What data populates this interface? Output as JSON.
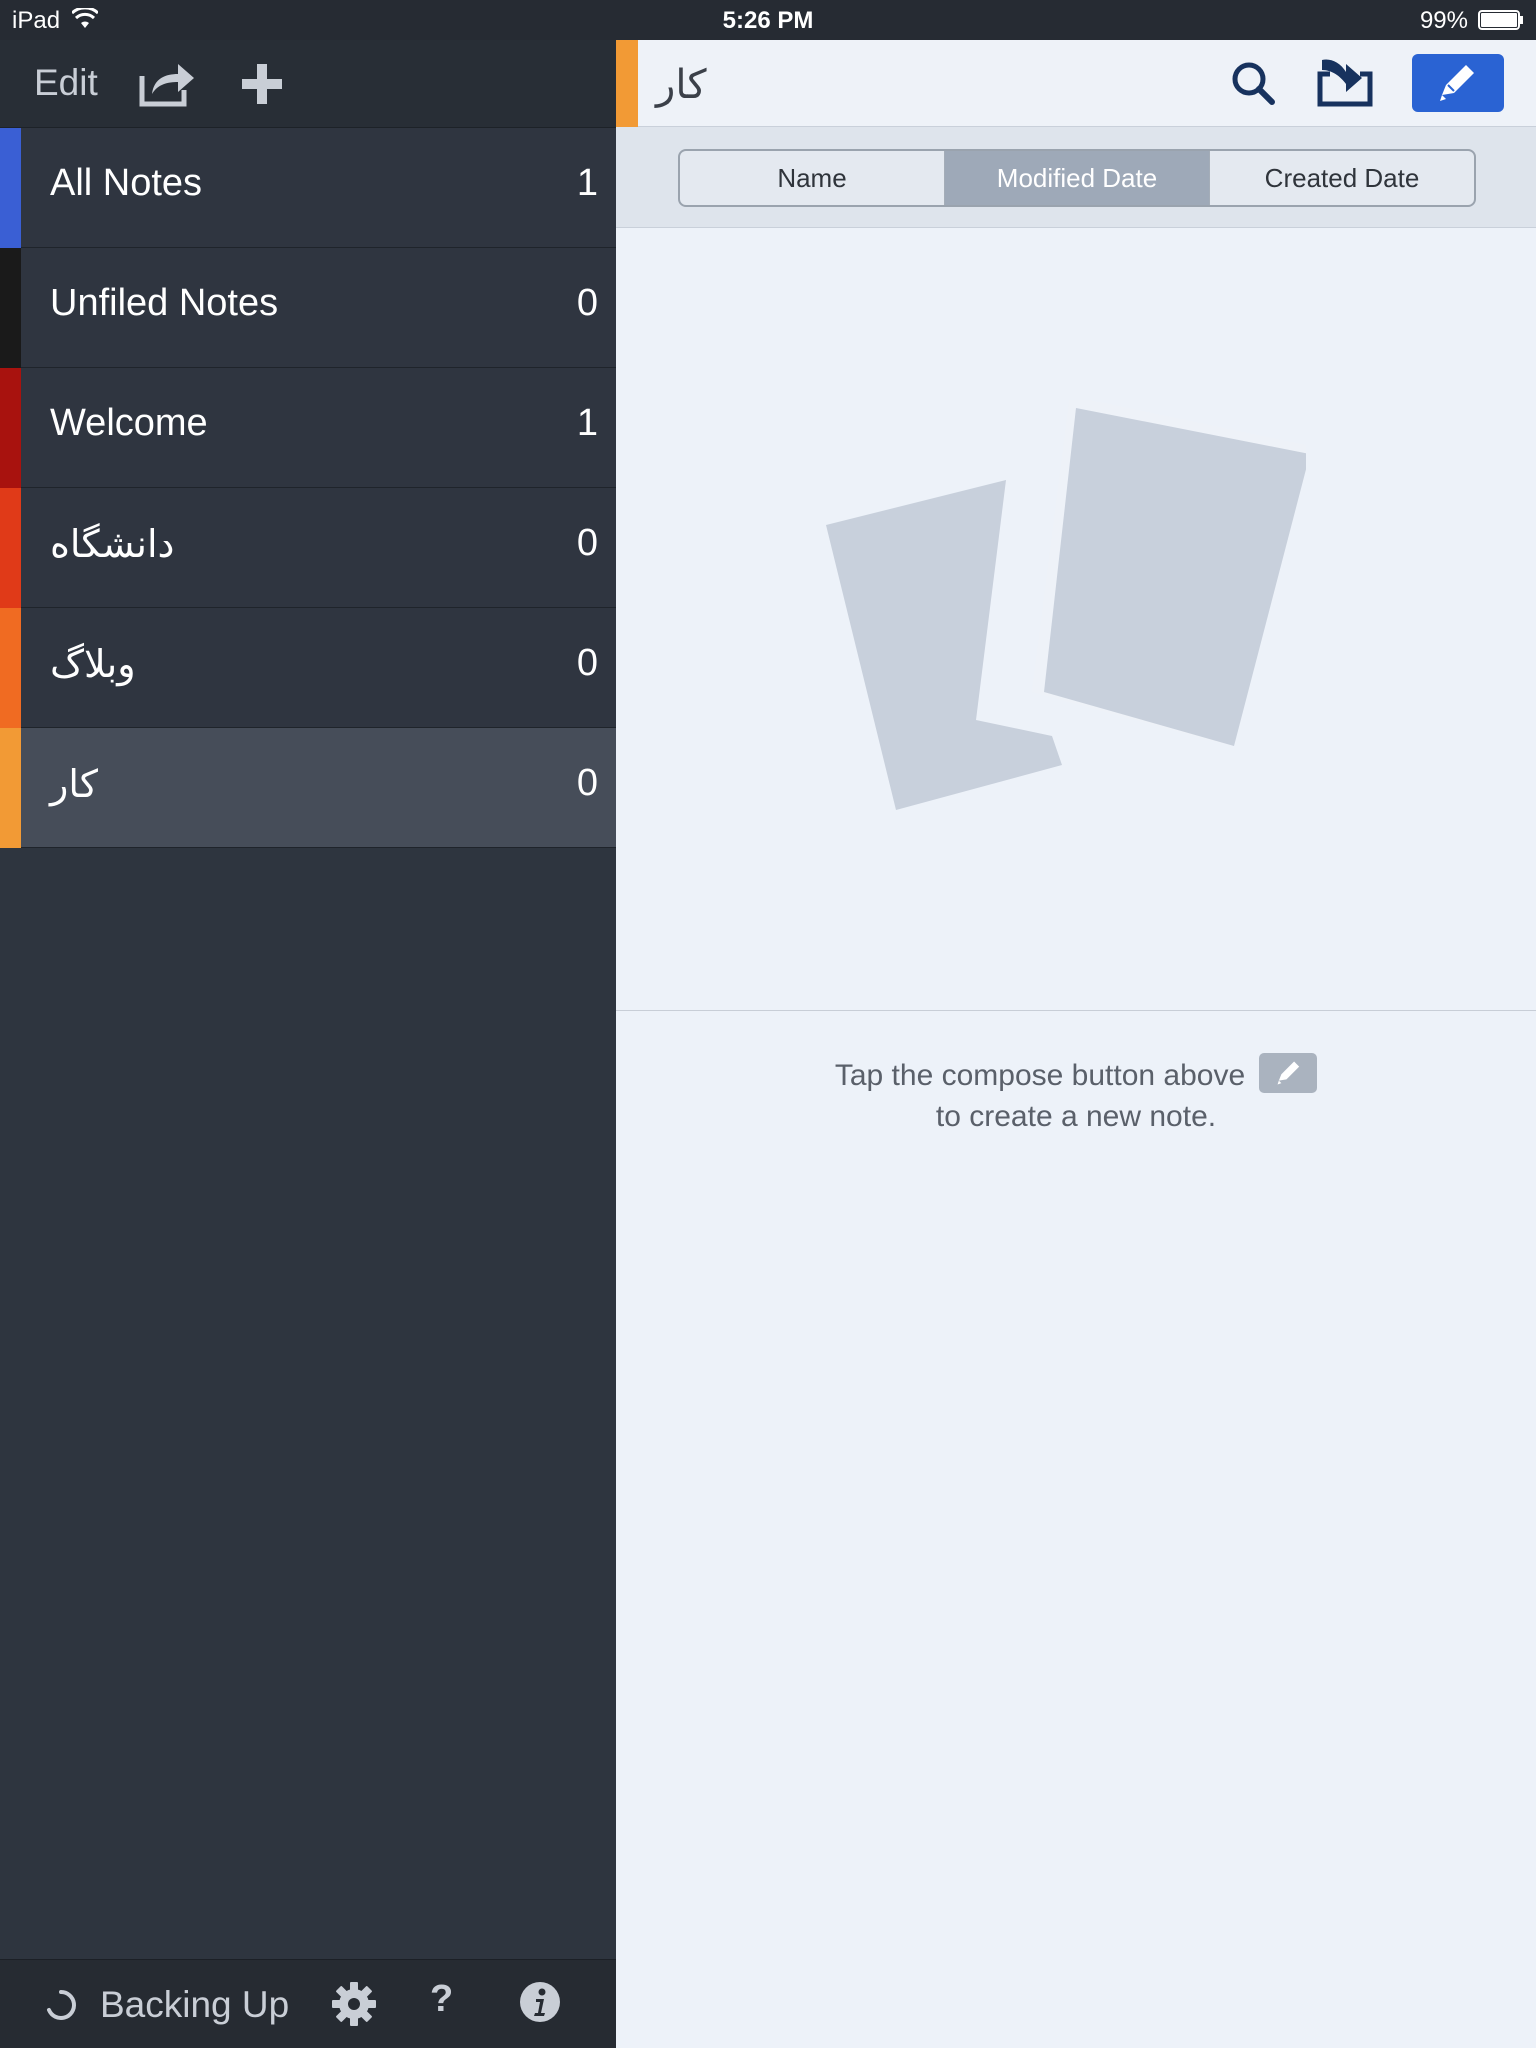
{
  "status_bar": {
    "device": "iPad",
    "time": "5:26 PM",
    "battery": "99%"
  },
  "sidebar": {
    "edit_label": "Edit",
    "notebooks": [
      {
        "name": "All Notes",
        "count": "1",
        "color": "#3a5fd4"
      },
      {
        "name": "Unfiled Notes",
        "count": "0",
        "color": "#1a1a1a"
      },
      {
        "name": "Welcome",
        "count": "1",
        "color": "#a8120e"
      },
      {
        "name": "دانشگاه",
        "count": "0",
        "color": "#e03a18"
      },
      {
        "name": "وبلاگ",
        "count": "0",
        "color": "#f06b22"
      },
      {
        "name": "کار",
        "count": "0",
        "color": "#f29a35"
      }
    ],
    "selected_index": 5,
    "backup_label": "Backing Up",
    "help_label": "?"
  },
  "main": {
    "header_title": "کار",
    "header_color": "#f29a35",
    "sort_options": [
      "Name",
      "Modified Date",
      "Created Date"
    ],
    "active_sort": "Modified Date",
    "hint_line1": "Tap the compose button above",
    "hint_line2": "to create a new note."
  },
  "colors": {
    "accent": "#2a63d3",
    "sidebar_bg": "#2e353f",
    "main_bg": "#edf2f9"
  },
  "icons": {
    "share": "share-icon",
    "add": "plus-icon",
    "search": "search-icon",
    "move": "move-to-notebook-icon",
    "compose": "pencil-icon",
    "settings": "gear-icon",
    "info": "info-icon"
  }
}
